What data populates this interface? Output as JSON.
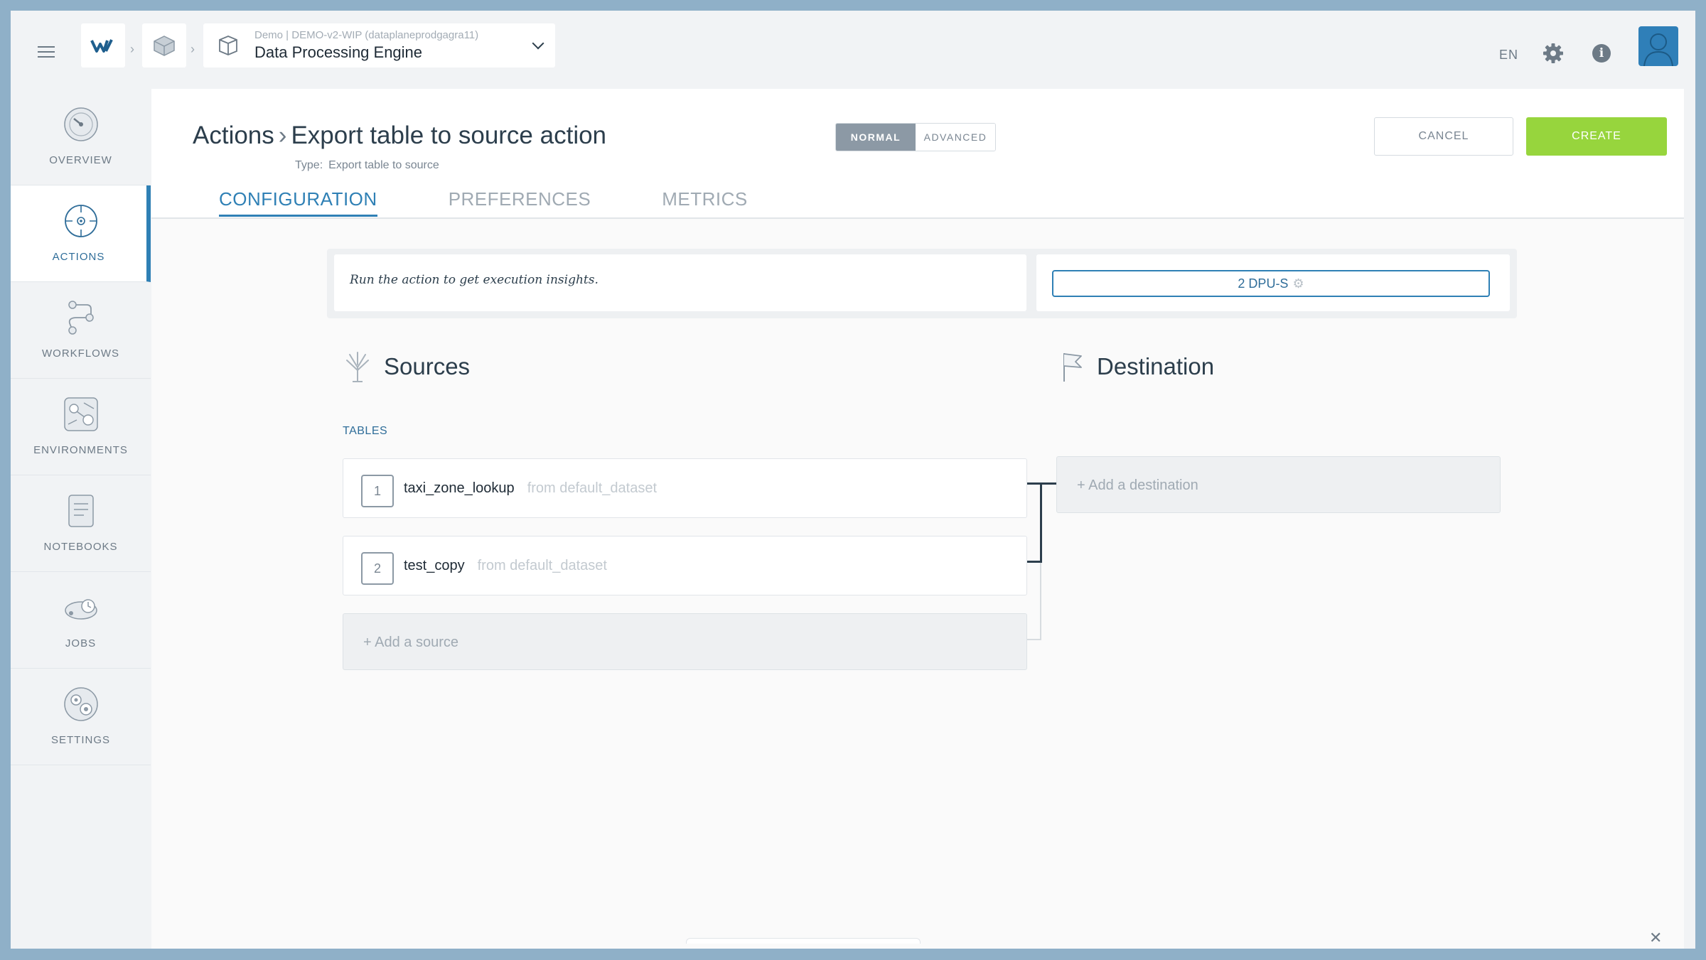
{
  "topbar": {
    "project_subtitle": "Demo | DEMO-v2-WIP (dataplaneprodgagra11)",
    "project_title": "Data Processing Engine",
    "language": "EN"
  },
  "sidebar": {
    "items": [
      {
        "label": "OVERVIEW",
        "icon": "speedometer-icon"
      },
      {
        "label": "ACTIONS",
        "icon": "crosshair-icon",
        "active": true
      },
      {
        "label": "WORKFLOWS",
        "icon": "workflow-icon"
      },
      {
        "label": "ENVIRONMENTS",
        "icon": "environment-icon"
      },
      {
        "label": "NOTEBOOKS",
        "icon": "notebook-icon"
      },
      {
        "label": "JOBS",
        "icon": "jobs-icon"
      },
      {
        "label": "SETTINGS",
        "icon": "settings-gears-icon"
      }
    ]
  },
  "header": {
    "breadcrumb_root": "Actions",
    "breadcrumb_current": "Export table to source action",
    "type_label": "Type:",
    "type_value": "Export table to source",
    "mode_normal": "NORMAL",
    "mode_advanced": "ADVANCED",
    "cancel_label": "CANCEL",
    "create_label": "CREATE"
  },
  "tabs": [
    "CONFIGURATION",
    "PREFERENCES",
    "METRICS"
  ],
  "insights": {
    "message": "Run the action to get execution insights.",
    "dpu_label": "2 DPU-S"
  },
  "sources": {
    "title": "Sources",
    "tables_label": "TABLES",
    "items": [
      {
        "index": "1",
        "name": "taxi_zone_lookup",
        "from": "from default_dataset"
      },
      {
        "index": "2",
        "name": "test_copy",
        "from": "from default_dataset"
      }
    ],
    "add_label": "+ Add a source"
  },
  "destination": {
    "title": "Destination",
    "add_label": "+ Add a destination"
  },
  "colors": {
    "accent": "#2f80b5",
    "create": "#97d53d",
    "mode_active": "#8c99a5"
  }
}
